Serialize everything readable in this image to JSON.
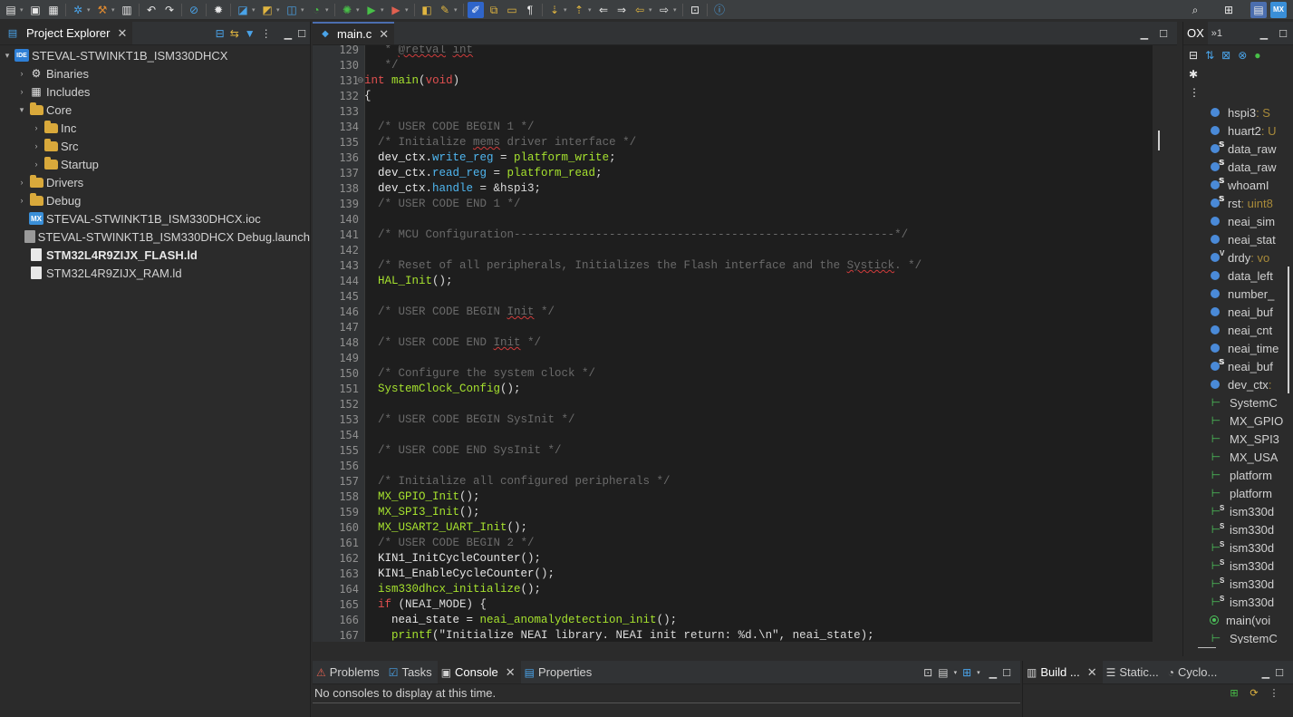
{
  "explorer": {
    "title": "Project Explorer",
    "items": [
      {
        "label": "STEVAL-STWINKT1B_ISM330DHCX",
        "indent": 0,
        "arrow": "▾",
        "icon": "ide-project-icon"
      },
      {
        "label": "Binaries",
        "indent": 1,
        "arrow": "›",
        "icon": "binaries-icon"
      },
      {
        "label": "Includes",
        "indent": 1,
        "arrow": "›",
        "icon": "includes-icon"
      },
      {
        "label": "Core",
        "indent": 1,
        "arrow": "▾",
        "icon": "source-folder-icon"
      },
      {
        "label": "Inc",
        "indent": 2,
        "arrow": "›",
        "icon": "folder-icon"
      },
      {
        "label": "Src",
        "indent": 2,
        "arrow": "›",
        "icon": "folder-icon"
      },
      {
        "label": "Startup",
        "indent": 2,
        "arrow": "›",
        "icon": "folder-icon"
      },
      {
        "label": "Drivers",
        "indent": 1,
        "arrow": "›",
        "icon": "source-folder-icon"
      },
      {
        "label": "Debug",
        "indent": 1,
        "arrow": "›",
        "icon": "folder-icon"
      },
      {
        "label": "STEVAL-STWINKT1B_ISM330DHCX.ioc",
        "indent": 1,
        "arrow": "",
        "icon": "mx-file-icon"
      },
      {
        "label": "STEVAL-STWINKT1B_ISM330DHCX Debug.launch",
        "indent": 1,
        "arrow": "",
        "icon": "launch-file-icon"
      },
      {
        "label": "STM32L4R9ZIJX_FLASH.ld",
        "indent": 1,
        "arrow": "",
        "icon": "ld-file-icon",
        "bold": true
      },
      {
        "label": "STM32L4R9ZIJX_RAM.ld",
        "indent": 1,
        "arrow": "",
        "icon": "ld-file-icon"
      }
    ]
  },
  "editor": {
    "tab_label": "main.c",
    "lines": [
      {
        "n": "129",
        "html": [
          [
            "cm",
            "   * "
          ],
          [
            "cm sq",
            "@retval"
          ],
          [
            "cm",
            " "
          ],
          [
            "cm sq",
            "int"
          ]
        ]
      },
      {
        "n": "130",
        "html": [
          [
            "cm",
            "   */"
          ]
        ]
      },
      {
        "n": "131",
        "fold": true,
        "html": [
          [
            "kw",
            "int"
          ],
          [
            "pl",
            " "
          ],
          [
            "fn",
            "main"
          ],
          [
            "pl",
            "("
          ],
          [
            "kw",
            "void"
          ],
          [
            "pl",
            ")"
          ]
        ]
      },
      {
        "n": "132",
        "html": [
          [
            "pl",
            "{"
          ]
        ]
      },
      {
        "n": "133",
        "html": []
      },
      {
        "n": "134",
        "html": [
          [
            "cm",
            "  /* USER CODE BEGIN 1 */"
          ]
        ]
      },
      {
        "n": "135",
        "html": [
          [
            "cm",
            "  /* Initialize "
          ],
          [
            "cm sq",
            "mems"
          ],
          [
            "cm",
            " driver interface */"
          ]
        ]
      },
      {
        "n": "136",
        "html": [
          [
            "id",
            "  dev_ctx."
          ],
          [
            "fld",
            "write_reg"
          ],
          [
            "pl",
            " = "
          ],
          [
            "fn",
            "platform_write"
          ],
          [
            "pl",
            ";"
          ]
        ]
      },
      {
        "n": "137",
        "html": [
          [
            "id",
            "  dev_ctx."
          ],
          [
            "fld",
            "read_reg"
          ],
          [
            "pl",
            " = "
          ],
          [
            "fn",
            "platform_read"
          ],
          [
            "pl",
            ";"
          ]
        ]
      },
      {
        "n": "138",
        "html": [
          [
            "id",
            "  dev_ctx."
          ],
          [
            "fld",
            "handle"
          ],
          [
            "pl",
            " = &hspi3;"
          ]
        ]
      },
      {
        "n": "139",
        "html": [
          [
            "cm",
            "  /* USER CODE END 1 */"
          ]
        ]
      },
      {
        "n": "140",
        "html": []
      },
      {
        "n": "141",
        "html": [
          [
            "cm",
            "  /* MCU Configuration--------------------------------------------------------*/"
          ]
        ]
      },
      {
        "n": "142",
        "html": []
      },
      {
        "n": "143",
        "html": [
          [
            "cm",
            "  /* Reset of all peripherals, Initializes the Flash interface and the "
          ],
          [
            "cm sq",
            "Systick"
          ],
          [
            "cm",
            ". */"
          ]
        ]
      },
      {
        "n": "144",
        "html": [
          [
            "fn",
            "  HAL_Init"
          ],
          [
            "pl",
            "();"
          ]
        ]
      },
      {
        "n": "145",
        "html": []
      },
      {
        "n": "146",
        "html": [
          [
            "cm",
            "  /* USER CODE BEGIN "
          ],
          [
            "cm sq",
            "Init"
          ],
          [
            "cm",
            " */"
          ]
        ]
      },
      {
        "n": "147",
        "html": []
      },
      {
        "n": "148",
        "html": [
          [
            "cm",
            "  /* USER CODE END "
          ],
          [
            "cm sq",
            "Init"
          ],
          [
            "cm",
            " */"
          ]
        ]
      },
      {
        "n": "149",
        "html": []
      },
      {
        "n": "150",
        "html": [
          [
            "cm",
            "  /* Configure the system clock */"
          ]
        ]
      },
      {
        "n": "151",
        "html": [
          [
            "fn",
            "  SystemClock_Config"
          ],
          [
            "pl",
            "();"
          ]
        ]
      },
      {
        "n": "152",
        "html": []
      },
      {
        "n": "153",
        "html": [
          [
            "cm",
            "  /* USER CODE BEGIN SysInit */"
          ]
        ]
      },
      {
        "n": "154",
        "html": []
      },
      {
        "n": "155",
        "html": [
          [
            "cm",
            "  /* USER CODE END SysInit */"
          ]
        ]
      },
      {
        "n": "156",
        "html": []
      },
      {
        "n": "157",
        "html": [
          [
            "cm",
            "  /* Initialize all configured peripherals */"
          ]
        ]
      },
      {
        "n": "158",
        "html": [
          [
            "fn",
            "  MX_GPIO_Init"
          ],
          [
            "pl",
            "();"
          ]
        ]
      },
      {
        "n": "159",
        "html": [
          [
            "fn",
            "  MX_SPI3_Init"
          ],
          [
            "pl",
            "();"
          ]
        ]
      },
      {
        "n": "160",
        "html": [
          [
            "fn",
            "  MX_USART2_UART_Init"
          ],
          [
            "pl",
            "();"
          ]
        ]
      },
      {
        "n": "161",
        "html": [
          [
            "cm",
            "  /* USER CODE BEGIN 2 */"
          ]
        ]
      },
      {
        "n": "162",
        "html": [
          [
            "id",
            "  KIN1_InitCycleCounter"
          ],
          [
            "pl",
            "();"
          ]
        ]
      },
      {
        "n": "163",
        "html": [
          [
            "id",
            "  KIN1_EnableCycleCounter"
          ],
          [
            "pl",
            "();"
          ]
        ]
      },
      {
        "n": "164",
        "html": [
          [
            "fn",
            "  ism330dhcx_initialize"
          ],
          [
            "pl",
            "();"
          ]
        ]
      },
      {
        "n": "165",
        "html": [
          [
            "kw",
            "  if"
          ],
          [
            "pl",
            " (NEAI_MODE) {"
          ]
        ]
      },
      {
        "n": "166",
        "html": [
          [
            "id",
            "    neai_state = "
          ],
          [
            "fn",
            "neai_anomalydetection_init"
          ],
          [
            "pl",
            "();"
          ]
        ]
      },
      {
        "n": "167",
        "html": [
          [
            "fn",
            "    printf"
          ],
          [
            "pl",
            "(\"Initialize NEAI library. NEAI init return: %d.\\n\", neai_state);"
          ]
        ]
      }
    ]
  },
  "outline": {
    "tab_label": "OX",
    "tab2_label": "»1",
    "items": [
      {
        "label": "hspi3",
        "type": " : S",
        "kind": "var"
      },
      {
        "label": "huart2",
        "type": " : U",
        "kind": "var"
      },
      {
        "label": "data_raw",
        "type": "",
        "kind": "static"
      },
      {
        "label": "data_raw",
        "type": "",
        "kind": "static"
      },
      {
        "label": "whoamI",
        "type": "",
        "kind": "static"
      },
      {
        "label": "rst",
        "type": " : uint8",
        "kind": "static"
      },
      {
        "label": "neai_sim",
        "type": "",
        "kind": "var"
      },
      {
        "label": "neai_stat",
        "type": "",
        "kind": "var"
      },
      {
        "label": "drdy",
        "type": " : vo",
        "kind": "volatile"
      },
      {
        "label": "data_left",
        "type": "",
        "kind": "var"
      },
      {
        "label": "number_",
        "type": "",
        "kind": "var"
      },
      {
        "label": "neai_buf",
        "type": "",
        "kind": "var"
      },
      {
        "label": "neai_cnt",
        "type": "",
        "kind": "var"
      },
      {
        "label": "neai_time",
        "type": "",
        "kind": "var"
      },
      {
        "label": "neai_buf",
        "type": "",
        "kind": "static"
      },
      {
        "label": "dev_ctx",
        "type": " :",
        "kind": "var"
      },
      {
        "label": "SystemC",
        "type": "",
        "kind": "fn"
      },
      {
        "label": "MX_GPIO",
        "type": "",
        "kind": "fn"
      },
      {
        "label": "MX_SPI3",
        "type": "",
        "kind": "fn"
      },
      {
        "label": "MX_USA",
        "type": "",
        "kind": "fn"
      },
      {
        "label": "platform",
        "type": "",
        "kind": "fn"
      },
      {
        "label": "platform",
        "type": "",
        "kind": "fn"
      },
      {
        "label": "ism330d",
        "type": "",
        "kind": "fn-s"
      },
      {
        "label": "ism330d",
        "type": "",
        "kind": "fn-s"
      },
      {
        "label": "ism330d",
        "type": "",
        "kind": "fn-s"
      },
      {
        "label": "ism330d",
        "type": "",
        "kind": "fn-s"
      },
      {
        "label": "ism330d",
        "type": "",
        "kind": "fn-s"
      },
      {
        "label": "ism330d",
        "type": "",
        "kind": "fn-s"
      },
      {
        "label": "main(voi",
        "type": "",
        "kind": "main"
      },
      {
        "label": "SystemC",
        "type": "",
        "kind": "fn"
      }
    ]
  },
  "console": {
    "tabs": [
      {
        "label": "Problems",
        "icon": "problems-icon"
      },
      {
        "label": "Tasks",
        "icon": "tasks-icon"
      },
      {
        "label": "Console",
        "icon": "console-icon",
        "active": true
      },
      {
        "label": "Properties",
        "icon": "properties-icon"
      }
    ],
    "message": "No consoles to display at this time."
  },
  "build": {
    "tabs": [
      {
        "label": "Build ...",
        "icon": "build-analyzer-icon",
        "active": true
      },
      {
        "label": "Static...",
        "icon": "static-stack-icon"
      },
      {
        "label": "Cyclo...",
        "icon": "cyclomatic-icon"
      }
    ]
  },
  "colors": {
    "accent": "#2f65ca",
    "background": "#2b2b2b",
    "comment": "#6a6a6a",
    "keyword": "#e25050",
    "function": "#a6e22e",
    "field": "#4fb6f0"
  }
}
